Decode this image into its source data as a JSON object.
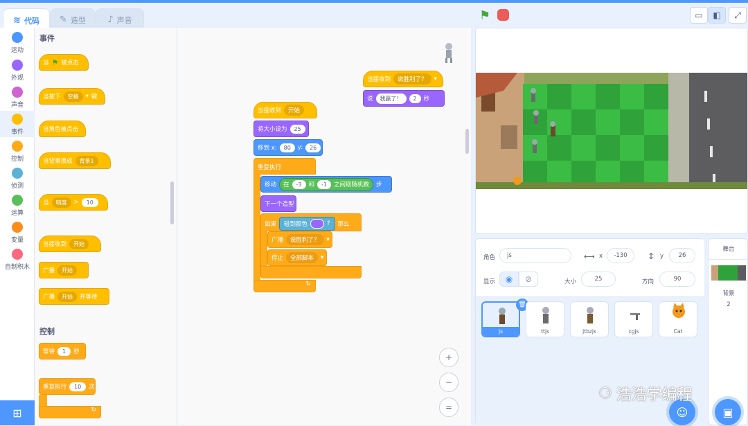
{
  "tabs": [
    {
      "label": "代码",
      "icon": "code-icon"
    },
    {
      "label": "造型",
      "icon": "brush-icon"
    },
    {
      "label": "声音",
      "icon": "speaker-icon"
    }
  ],
  "categories": [
    {
      "label": "运动",
      "color": "#4c97ff"
    },
    {
      "label": "外观",
      "color": "#9966ff"
    },
    {
      "label": "声音",
      "color": "#cf63cf"
    },
    {
      "label": "事件",
      "color": "#ffbf00"
    },
    {
      "label": "控制",
      "color": "#ffab19"
    },
    {
      "label": "侦测",
      "color": "#5cb1d6"
    },
    {
      "label": "运算",
      "color": "#59c059"
    },
    {
      "label": "变量",
      "color": "#ff8c1a"
    },
    {
      "label": "自制积木",
      "color": "#ff6680"
    }
  ],
  "palette": {
    "events_title": "事件",
    "when_flag_prefix": "当",
    "when_flag_suffix": "被点击",
    "when_key_prefix": "当按下",
    "when_key_dd": "空格",
    "when_key_suffix": "键",
    "when_sprite_clicked": "当角色被点击",
    "when_backdrop_prefix": "当背景换成",
    "when_backdrop_dd": "背景1",
    "when_loud_prefix": "当",
    "when_loud_dd": "响度",
    "when_loud_op": ">",
    "when_loud_val": "10",
    "when_receive_prefix": "当接收到",
    "when_receive_dd": "开始",
    "broadcast_prefix": "广播",
    "broadcast_dd": "开始",
    "broadcast_wait_prefix": "广播",
    "broadcast_wait_dd": "开始",
    "broadcast_wait_suffix": "并等待",
    "control_title": "控制",
    "wait_prefix": "等待",
    "wait_val": "1",
    "wait_suffix": "秒",
    "repeat_prefix": "重复执行",
    "repeat_val": "10",
    "repeat_suffix": "次"
  },
  "script1": {
    "hat_prefix": "当接收到",
    "hat_dd": "开始",
    "size_prefix": "将大小设为",
    "size_val": "25",
    "goto_prefix": "移到 x:",
    "goto_x": "80",
    "goto_y_label": "y:",
    "goto_y": "26",
    "forever": "重复执行",
    "move_prefix": "移动",
    "rand_in": "在",
    "rand_a": "-3",
    "rand_and": "和",
    "rand_b": "-1",
    "rand_suffix": "之间取随机数",
    "move_suffix": "步",
    "next_costume": "下一个造型",
    "if_prefix": "如果",
    "touch_color": "碰到颜色",
    "touch_q": "?",
    "if_then": "那么",
    "broadcast_prefix": "广播",
    "broadcast_dd": "说胜利了？",
    "stop_prefix": "停止",
    "stop_dd": "全部脚本"
  },
  "script2": {
    "hat_prefix": "当接收到",
    "hat_dd": "说胜利了？",
    "say_prefix": "说",
    "say_text": "我赢了！",
    "say_secs": "2",
    "say_suffix": "秒"
  },
  "zoom": {
    "in": "+",
    "out": "−",
    "reset": "="
  },
  "sprite_info": {
    "sprite_label": "角色",
    "sprite_name": "js",
    "x_label": "x",
    "x_val": "-130",
    "y_label": "y",
    "y_val": "26",
    "show_label": "显示",
    "size_label": "大小",
    "size_val": "25",
    "dir_label": "方向",
    "dir_val": "90"
  },
  "sprites": [
    {
      "name": "js"
    },
    {
      "name": "ttjs"
    },
    {
      "name": "jtbzjs"
    },
    {
      "name": "cgjs"
    },
    {
      "name": "Cat"
    }
  ],
  "stage_target": {
    "title": "舞台",
    "backdrop_label": "背景",
    "backdrop_count": "2"
  },
  "watermark": "浩浩学编程"
}
